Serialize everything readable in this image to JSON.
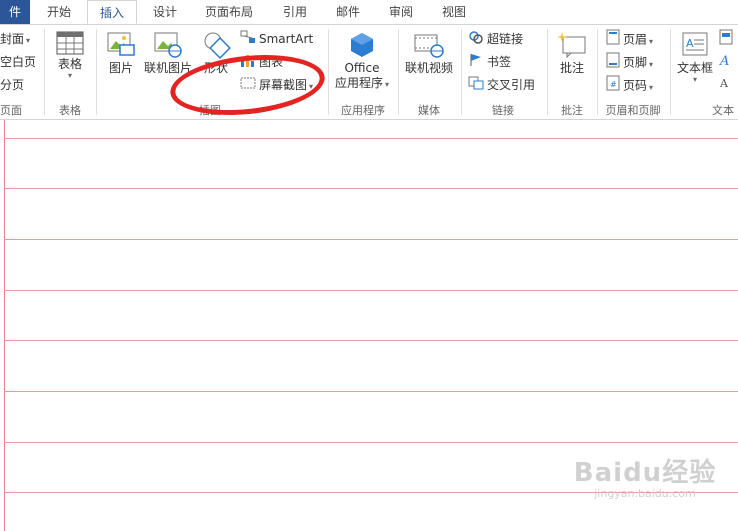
{
  "tabs": {
    "file": "件",
    "home": "开始",
    "insert": "插入",
    "design": "设计",
    "layout": "页面布局",
    "references": "引用",
    "mailings": "邮件",
    "review": "审阅",
    "view": "视图"
  },
  "pages_group": {
    "cover": "封面",
    "blank": "空白页",
    "break": "分页",
    "label": "页面"
  },
  "tables_group": {
    "table": "表格",
    "label": "表格"
  },
  "illustrations_group": {
    "picture": "图片",
    "online_picture": "联机图片",
    "shapes": "形状",
    "smartart": "SmartArt",
    "chart": "图表",
    "screenshot": "屏幕截图",
    "label": "插图"
  },
  "apps_group": {
    "office_line1": "Office",
    "office_line2": "应用程序",
    "label": "应用程序"
  },
  "media_group": {
    "online_video": "联机视频",
    "label": "媒体"
  },
  "links_group": {
    "hyperlink": "超链接",
    "bookmark": "书签",
    "cross_ref": "交叉引用",
    "label": "链接"
  },
  "comments_group": {
    "comment": "批注",
    "label": "批注"
  },
  "header_footer_group": {
    "header": "页眉",
    "footer": "页脚",
    "page_number": "页码",
    "label": "页眉和页脚"
  },
  "text_group": {
    "textbox": "文本框",
    "label": "文本"
  },
  "watermark": {
    "brand": "Baidu经验",
    "url": "jingyan.baidu.com"
  },
  "colors": {
    "accent": "#2b579a",
    "annotation": "#e52421",
    "ruled_line": "#ec9aa0"
  }
}
